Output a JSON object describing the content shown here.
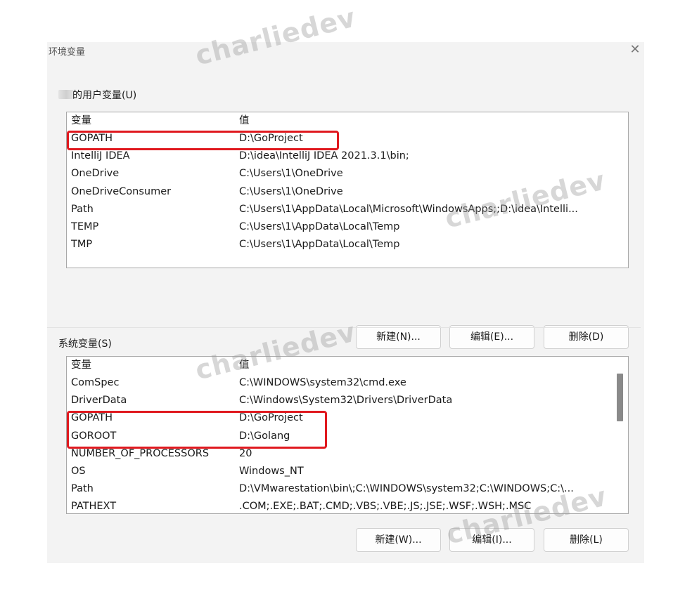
{
  "dialog": {
    "title": "环境变量",
    "close_glyph": "✕"
  },
  "user_vars": {
    "label": "的用户变量(U)",
    "header": {
      "name": "变量",
      "value": "值"
    },
    "rows": [
      {
        "name": "GOPATH",
        "value": "D:\\GoProject"
      },
      {
        "name": "IntelliJ IDEA",
        "value": "D:\\idea\\IntelliJ IDEA 2021.3.1\\bin;"
      },
      {
        "name": "OneDrive",
        "value": "C:\\Users\\1\\OneDrive"
      },
      {
        "name": "OneDriveConsumer",
        "value": "C:\\Users\\1\\OneDrive"
      },
      {
        "name": "Path",
        "value": "C:\\Users\\1\\AppData\\Local\\Microsoft\\WindowsApps;;D:\\idea\\Intelli..."
      },
      {
        "name": "TEMP",
        "value": "C:\\Users\\1\\AppData\\Local\\Temp"
      },
      {
        "name": "TMP",
        "value": "C:\\Users\\1\\AppData\\Local\\Temp"
      }
    ],
    "buttons": {
      "new": "新建(N)...",
      "edit": "编辑(E)...",
      "delete": "删除(D)"
    }
  },
  "system_vars": {
    "label": "系统变量(S)",
    "header": {
      "name": "变量",
      "value": "值"
    },
    "rows": [
      {
        "name": "ComSpec",
        "value": "C:\\WINDOWS\\system32\\cmd.exe"
      },
      {
        "name": "DriverData",
        "value": "C:\\Windows\\System32\\Drivers\\DriverData"
      },
      {
        "name": "GOPATH",
        "value": "D:\\GoProject"
      },
      {
        "name": "GOROOT",
        "value": "D:\\Golang"
      },
      {
        "name": "NUMBER_OF_PROCESSORS",
        "value": "20"
      },
      {
        "name": "OS",
        "value": "Windows_NT"
      },
      {
        "name": "Path",
        "value": "D:\\VMwarestation\\bin\\;C:\\WINDOWS\\system32;C:\\WINDOWS;C:\\..."
      },
      {
        "name": "PATHEXT",
        "value": ".COM;.EXE;.BAT;.CMD;.VBS;.VBE;.JS;.JSE;.WSF;.WSH;.MSC"
      }
    ],
    "buttons": {
      "new": "新建(W)...",
      "edit": "编辑(I)...",
      "delete": "删除(L)"
    }
  },
  "watermark": "charliedev",
  "highlight_color": "#e0191f"
}
